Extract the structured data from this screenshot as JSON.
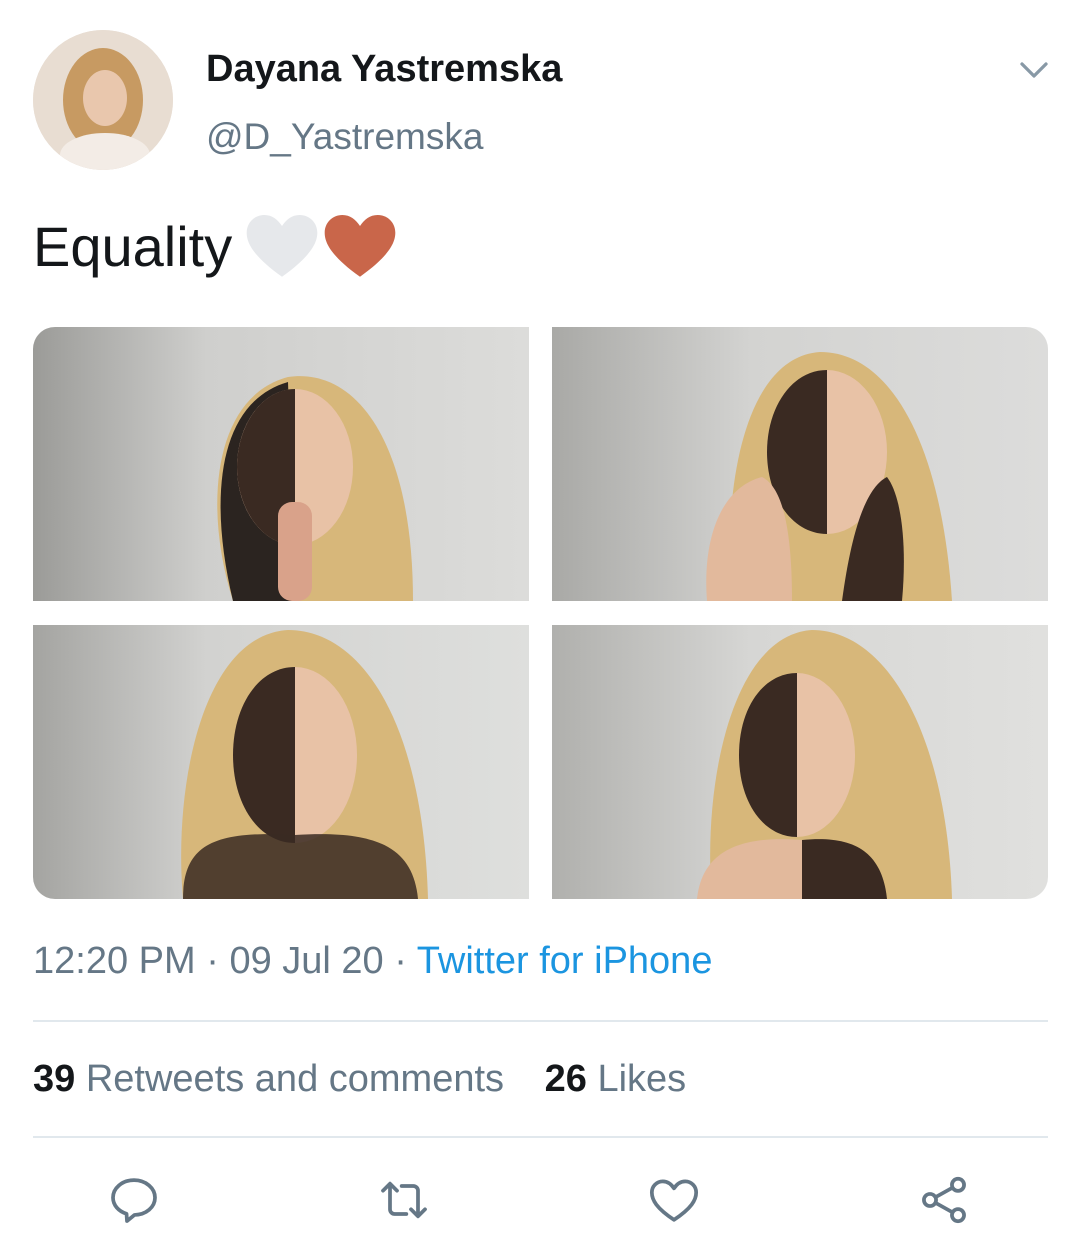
{
  "user": {
    "name": "Dayana Yastremska",
    "handle": "@D_Yastremska"
  },
  "tweet": {
    "text": "Equality",
    "emoji": [
      "white-heart",
      "brown-heart"
    ]
  },
  "photos": [
    "photo-1",
    "photo-2",
    "photo-3",
    "photo-4"
  ],
  "meta": {
    "time": "12:20 PM",
    "sep1": " · ",
    "date": "09 Jul 20",
    "sep2": " · ",
    "source": "Twitter for iPhone"
  },
  "stats": {
    "retweets_count": "39",
    "retweets_label": "Retweets and comments",
    "likes_count": "26",
    "likes_label": "Likes"
  },
  "icons": [
    "reply-icon",
    "retweet-icon",
    "like-icon",
    "share-icon"
  ],
  "colors": {
    "link": "#1b95e0",
    "muted": "#657786",
    "heart_brown": "#c9664a",
    "heart_white": "#e6e8eb"
  }
}
